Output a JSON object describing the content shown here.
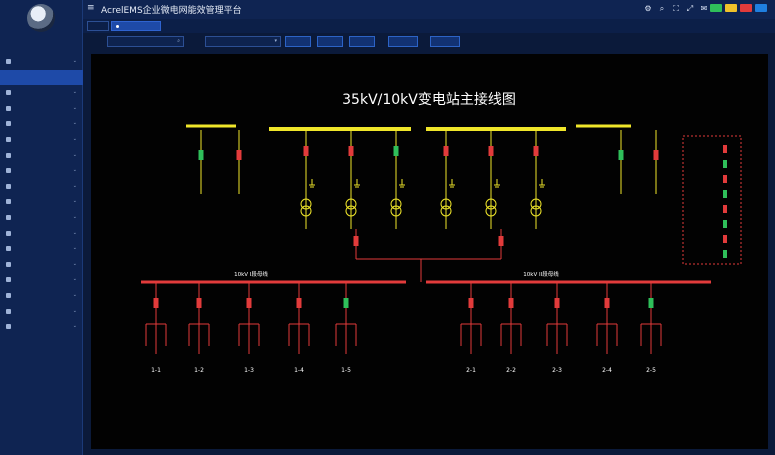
{
  "app": {
    "title": "AcrelEMS企业微电网能效管理平台",
    "menu_icon": "hamburger-icon",
    "user": "",
    "toolbar_icons": [
      "settings-icon",
      "search-icon",
      "fullscreen-icon",
      "expand-icon",
      "message-icon",
      "user-icon"
    ],
    "themes": [
      "#2fbf5a",
      "#f0c22a",
      "#e23b3b",
      "#1f7fe0"
    ]
  },
  "sidebar": {
    "items": [
      {
        "label": "",
        "icon": "home-icon",
        "active": false,
        "sub": false
      },
      {
        "label": "",
        "icon": "",
        "active": true,
        "sub": true
      },
      {
        "label": "",
        "icon": "monitor-icon",
        "active": false,
        "sub": false
      },
      {
        "label": "",
        "icon": "energy-icon",
        "active": false,
        "sub": false
      },
      {
        "label": "",
        "icon": "chart-icon",
        "active": false,
        "sub": false
      },
      {
        "label": "",
        "icon": "power-icon",
        "active": false,
        "sub": false
      },
      {
        "label": "",
        "icon": "stats-icon",
        "active": false,
        "sub": false
      },
      {
        "label": "",
        "icon": "report-icon",
        "active": false,
        "sub": false
      },
      {
        "label": "",
        "icon": "analysis-icon",
        "active": false,
        "sub": false
      },
      {
        "label": "",
        "icon": "alarm-icon",
        "active": false,
        "sub": false
      },
      {
        "label": "",
        "icon": "operation-icon",
        "active": false,
        "sub": false
      },
      {
        "label": "",
        "icon": "device-icon",
        "active": false,
        "sub": false
      },
      {
        "label": "",
        "icon": "env-icon",
        "active": false,
        "sub": false
      },
      {
        "label": "",
        "icon": "video-icon",
        "active": false,
        "sub": false
      },
      {
        "label": "",
        "icon": "screen-icon",
        "active": false,
        "sub": false
      },
      {
        "label": "",
        "icon": "setting-icon",
        "active": false,
        "sub": false
      },
      {
        "label": "",
        "icon": "system-icon",
        "active": false,
        "sub": false
      },
      {
        "label": "",
        "icon": "log-icon",
        "active": false,
        "sub": false
      },
      {
        "label": "",
        "icon": "",
        "active": false,
        "sub": false
      }
    ]
  },
  "tabs": [
    {
      "label": "",
      "active": false
    },
    {
      "label": "",
      "active": true
    }
  ],
  "toolbar": {
    "label": "",
    "select_value": "",
    "select2_value": "",
    "buttons": [
      "",
      "",
      "",
      "",
      ""
    ]
  },
  "diagram": {
    "title": "35kV/10kV变电站主接线图",
    "top_left_label": "",
    "top_right_label": "",
    "middle_label": "",
    "left_feed_label": "",
    "right_feed_label": "",
    "bus_left_label": "10kV I段母线",
    "bus_right_label": "10kV II段母线",
    "feeders_left": [
      "1-1",
      "1-2",
      "1-3",
      "1-4",
      "1-5"
    ],
    "feeders_right": [
      "2-1",
      "2-2",
      "2-3",
      "2-4",
      "2-5"
    ],
    "metric_keys": [
      "",
      "",
      "",
      "",
      ""
    ],
    "legend": [
      {
        "label": "",
        "color": "#e23b3b"
      },
      {
        "label": "",
        "color": "#2fbf5a"
      },
      {
        "label": "",
        "color": "#e23b3b"
      },
      {
        "label": "",
        "color": "#2fbf5a"
      },
      {
        "label": "",
        "color": "#e23b3b"
      },
      {
        "label": "",
        "color": "#2fbf5a"
      },
      {
        "label": "",
        "color": "#e23b3b"
      },
      {
        "label": "",
        "color": "#2fbf5a"
      }
    ],
    "colors": {
      "bus_yellow": "#f0e62a",
      "bus_red": "#e23b3b",
      "closed": "#e23b3b",
      "open": "#2fbf5a",
      "text": "#ffffff"
    }
  }
}
